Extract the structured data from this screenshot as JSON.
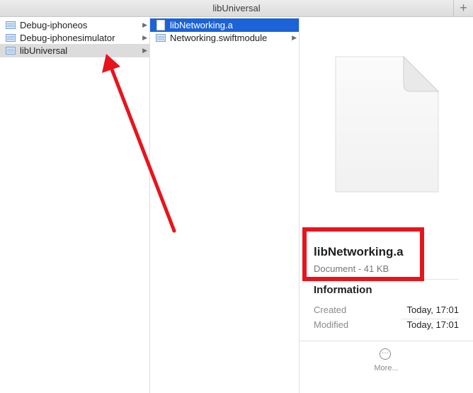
{
  "window": {
    "title": "libUniversal",
    "plus_glyph": "+"
  },
  "column1": {
    "items": [
      {
        "label": "Debug-iphoneos",
        "icon": "folder-icon"
      },
      {
        "label": "Debug-iphonesimulator",
        "icon": "folder-icon"
      },
      {
        "label": "libUniversal",
        "icon": "folder-icon"
      }
    ],
    "chevron": "▶"
  },
  "column2": {
    "items": [
      {
        "label": "libNetworking.a",
        "icon": "document-icon"
      },
      {
        "label": "Networking.swiftmodule",
        "icon": "folder-icon"
      }
    ],
    "chevron": "▶"
  },
  "preview": {
    "name": "libNetworking.a",
    "kind": "Document - 41 KB",
    "info_heading": "Information",
    "meta": [
      {
        "key": "Created",
        "value": "Today, 17:01"
      },
      {
        "key": "Modified",
        "value": "Today, 17:01"
      }
    ],
    "more_glyph": "···",
    "more_label": "More..."
  },
  "colors": {
    "selection_blue": "#1b63d6",
    "selection_grey": "#dcdcdc",
    "annotation_red": "#e8141c"
  }
}
